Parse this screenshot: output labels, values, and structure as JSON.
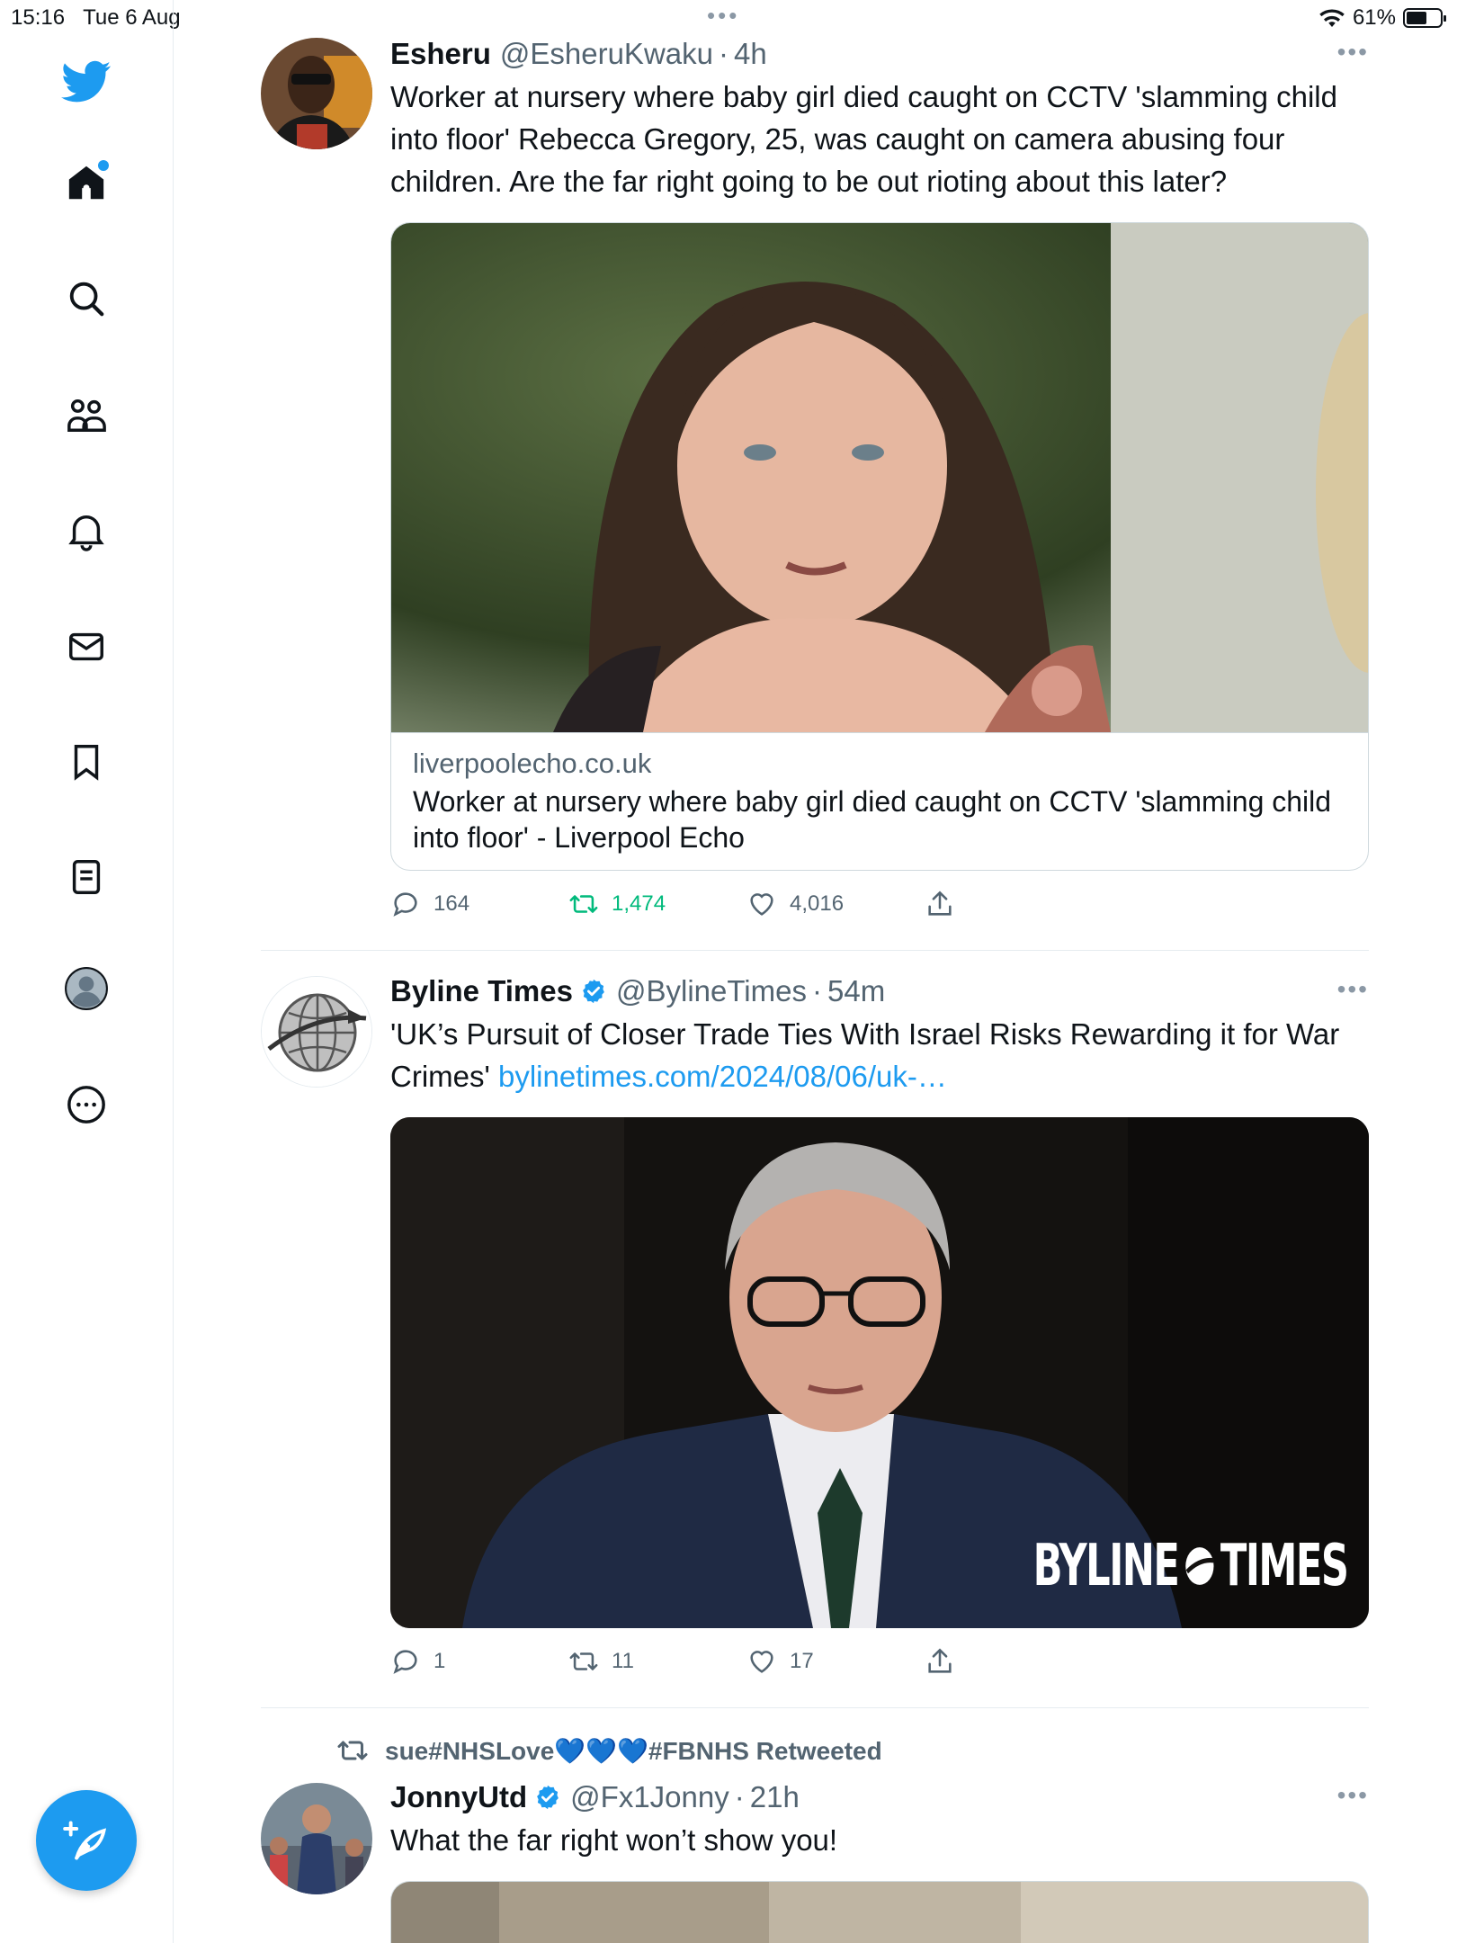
{
  "status_bar": {
    "time": "15:16",
    "date": "Tue 6 Aug",
    "battery_percent": "61%",
    "battery_level": 0.61
  },
  "sidebar": {
    "items": [
      {
        "icon": "twitter-bird-icon"
      },
      {
        "icon": "home-icon",
        "has_notification_dot": true
      },
      {
        "icon": "search-icon"
      },
      {
        "icon": "communities-icon"
      },
      {
        "icon": "notifications-bell-icon"
      },
      {
        "icon": "messages-envelope-icon"
      },
      {
        "icon": "bookmark-icon"
      },
      {
        "icon": "lists-icon"
      },
      {
        "icon": "profile-avatar-icon"
      },
      {
        "icon": "more-circle-icon"
      }
    ],
    "compose_icon": "compose-feather-icon"
  },
  "tweets": [
    {
      "name": "Esheru",
      "handle": "@EsheruKwaku",
      "sep": "·",
      "time": "4h",
      "verified": false,
      "text": "Worker at nursery where baby girl died caught on CCTV 'slamming child into floor' Rebecca Gregory, 25, was caught on camera abusing four children. Are the far right going to be out rioting about this later?",
      "card": {
        "domain": "liverpoolecho.co.uk",
        "title": "Worker at nursery where baby girl died caught on CCTV 'slamming child into floor' - Liverpool Echo"
      },
      "replies": "164",
      "retweets": "1,474",
      "likes": "4,016",
      "retweeted_by_me": true
    },
    {
      "name": "Byline Times",
      "handle": "@BylineTimes",
      "sep": "·",
      "time": "54m",
      "verified": true,
      "text": "'UK’s Pursuit of Closer Trade Ties With Israel Risks Rewarding it for War Crimes' ",
      "link": "bylinetimes.com/2024/08/06/uk-…",
      "image_watermark": "BYLINE",
      "image_watermark_2": "TIMES",
      "replies": "1",
      "retweets": "11",
      "likes": "17"
    },
    {
      "retweeted_by": "sue#NHSLove💙💙💙#FBNHS Retweeted",
      "name": "JonnyUtd",
      "handle": "@Fx1Jonny",
      "sep": "·",
      "time": "21h",
      "verified": true,
      "text": "What the far right won’t show you!"
    }
  ],
  "colors": {
    "accent": "#1d9bf0",
    "retweet_green": "#00ba7c",
    "secondary_text": "#536471"
  }
}
